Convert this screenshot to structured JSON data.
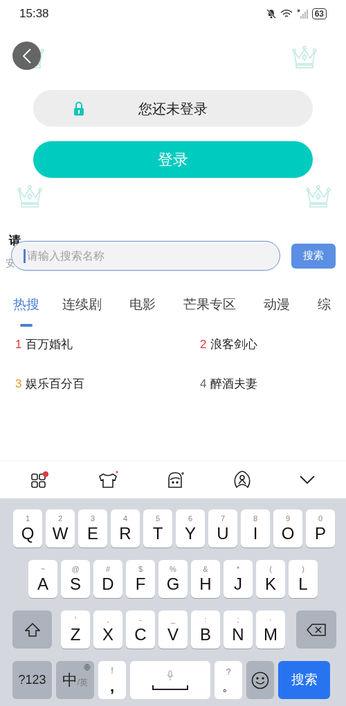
{
  "status_bar": {
    "time": "15:38",
    "battery": "63"
  },
  "login_status": {
    "text": "您还未登录"
  },
  "login_button": {
    "label": "登录"
  },
  "background_text": {
    "notice": "请",
    "side": "安"
  },
  "search": {
    "placeholder": "请输入搜索名称",
    "button": "搜索"
  },
  "tabs": [
    {
      "label": "热搜",
      "selected": true
    },
    {
      "label": "连续剧",
      "selected": false
    },
    {
      "label": "电影",
      "selected": false
    },
    {
      "label": "芒果专区",
      "selected": false
    },
    {
      "label": "动漫",
      "selected": false
    },
    {
      "label": "综",
      "selected": false
    }
  ],
  "hot_list": [
    {
      "rank": "1",
      "title": "百万婚礼",
      "color": "#e0393e"
    },
    {
      "rank": "2",
      "title": "浪客剑心",
      "color": "#e0393e"
    },
    {
      "rank": "3",
      "title": "娱乐百分百",
      "color": "#e79a2a"
    },
    {
      "rank": "4",
      "title": "醉酒夫妻",
      "color": "#666666"
    }
  ],
  "keyboard": {
    "rows": [
      [
        {
          "hint": "1",
          "key": "Q"
        },
        {
          "hint": "2",
          "key": "W"
        },
        {
          "hint": "3",
          "key": "E"
        },
        {
          "hint": "4",
          "key": "R"
        },
        {
          "hint": "5",
          "key": "T"
        },
        {
          "hint": "6",
          "key": "Y"
        },
        {
          "hint": "7",
          "key": "U"
        },
        {
          "hint": "8",
          "key": "I"
        },
        {
          "hint": "9",
          "key": "O"
        },
        {
          "hint": "0",
          "key": "P"
        }
      ],
      [
        {
          "hint": "~",
          "key": "A"
        },
        {
          "hint": "@",
          "key": "S"
        },
        {
          "hint": "#",
          "key": "D"
        },
        {
          "hint": "$",
          "key": "F"
        },
        {
          "hint": "%",
          "key": "G"
        },
        {
          "hint": "&",
          "key": "H"
        },
        {
          "hint": "*",
          "key": "J"
        },
        {
          "hint": "(",
          "key": "K"
        },
        {
          "hint": ")",
          "key": "L"
        }
      ],
      [
        {
          "hint": "'",
          "key": "Z"
        },
        {
          "hint": ",",
          "key": "X"
        },
        {
          "hint": "-",
          "key": "C"
        },
        {
          "hint": "_",
          "key": "V"
        },
        {
          "hint": ":",
          "key": "B"
        },
        {
          "hint": ";",
          "key": "N"
        },
        {
          "hint": "·",
          "key": "M"
        }
      ]
    ],
    "symbols_key": "?123",
    "lang_main": "中",
    "lang_alt": "/英",
    "comma_hint": "!",
    "comma": ",",
    "period_hint": "?",
    "period": "。",
    "action_key": "搜索"
  }
}
